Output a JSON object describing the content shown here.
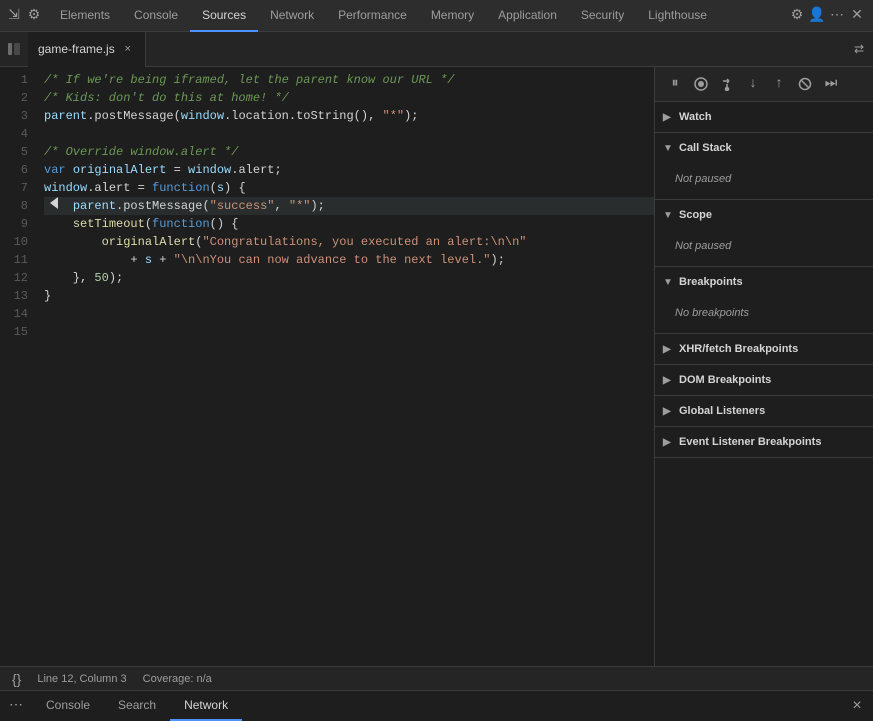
{
  "nav": {
    "tabs": [
      {
        "id": "elements",
        "label": "Elements",
        "active": false
      },
      {
        "id": "console",
        "label": "Console",
        "active": false
      },
      {
        "id": "sources",
        "label": "Sources",
        "active": true
      },
      {
        "id": "network",
        "label": "Network",
        "active": false
      },
      {
        "id": "performance",
        "label": "Performance",
        "active": false
      },
      {
        "id": "memory",
        "label": "Memory",
        "active": false
      },
      {
        "id": "application",
        "label": "Application",
        "active": false
      },
      {
        "id": "security",
        "label": "Security",
        "active": false
      },
      {
        "id": "lighthouse",
        "label": "Lighthouse",
        "active": false
      }
    ]
  },
  "file_tab": {
    "name": "game-frame.js",
    "close_label": "×"
  },
  "debug_toolbar": {
    "buttons": [
      {
        "id": "pause",
        "icon": "⏸",
        "label": "Pause"
      },
      {
        "id": "resume",
        "icon": "⏵",
        "label": "Resume"
      },
      {
        "id": "step-over",
        "icon": "↷",
        "label": "Step over"
      },
      {
        "id": "step-into",
        "icon": "↓",
        "label": "Step into"
      },
      {
        "id": "step-out",
        "icon": "↑",
        "label": "Step out"
      },
      {
        "id": "deactivate",
        "icon": "⬡",
        "label": "Deactivate breakpoints"
      },
      {
        "id": "dont-pause",
        "icon": "⏭",
        "label": "Don't pause on exceptions"
      }
    ]
  },
  "code": {
    "lines": [
      {
        "n": 1,
        "text": "/* If we're being iframed, let the parent know our URL */"
      },
      {
        "n": 2,
        "text": "/* Kids: don't do this at home! */"
      },
      {
        "n": 3,
        "text": "parent.postMessage(window.location.toString(), \"*\");"
      },
      {
        "n": 4,
        "text": ""
      },
      {
        "n": 5,
        "text": "/* Override window.alert */"
      },
      {
        "n": 6,
        "text": "var originalAlert = window.alert;"
      },
      {
        "n": 7,
        "text": "window.alert = function(s) {"
      },
      {
        "n": 8,
        "text": "    parent.postMessage(\"success\", \"*\");"
      },
      {
        "n": 9,
        "text": "    setTimeout(function() {"
      },
      {
        "n": 10,
        "text": "        originalAlert(\"Congratulations, you executed an alert:\\n\\n\""
      },
      {
        "n": 11,
        "text": "            + s + \"\\n\\nYou can now advance to the next level.\");"
      },
      {
        "n": 12,
        "text": "    }, 50);"
      },
      {
        "n": 13,
        "text": "}"
      },
      {
        "n": 14,
        "text": ""
      },
      {
        "n": 15,
        "text": ""
      }
    ]
  },
  "right_panel": {
    "sections": [
      {
        "id": "watch",
        "label": "Watch",
        "expanded": false,
        "content": null
      },
      {
        "id": "call-stack",
        "label": "Call Stack",
        "expanded": true,
        "content": "Not paused"
      },
      {
        "id": "scope",
        "label": "Scope",
        "expanded": true,
        "content": "Not paused"
      },
      {
        "id": "breakpoints",
        "label": "Breakpoints",
        "expanded": true,
        "content": "No breakpoints"
      },
      {
        "id": "xhr-fetch",
        "label": "XHR/fetch Breakpoints",
        "expanded": false,
        "content": null
      },
      {
        "id": "dom-breakpoints",
        "label": "DOM Breakpoints",
        "expanded": false,
        "content": null
      },
      {
        "id": "global-listeners",
        "label": "Global Listeners",
        "expanded": false,
        "content": null
      },
      {
        "id": "event-listener-breakpoints",
        "label": "Event Listener Breakpoints",
        "expanded": false,
        "content": null
      }
    ]
  },
  "status_bar": {
    "line_col": "Line 12, Column 3",
    "coverage": "Coverage: n/a",
    "icon": "{}"
  },
  "bottom_tabs": {
    "tabs": [
      {
        "id": "console",
        "label": "Console",
        "active": false
      },
      {
        "id": "search",
        "label": "Search",
        "active": false
      },
      {
        "id": "network",
        "label": "Network",
        "active": true
      }
    ],
    "close_label": "×"
  }
}
